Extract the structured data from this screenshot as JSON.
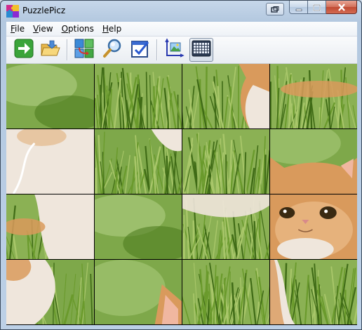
{
  "window": {
    "title": "PuzzlePicz"
  },
  "menu": [
    "File",
    "View",
    "Options",
    "Help"
  ],
  "toolbar": {
    "buttons": [
      {
        "name": "start-button",
        "icon": "green-arrow-icon"
      },
      {
        "name": "open-button",
        "icon": "open-folder-icon"
      },
      {
        "name": "shuffle-button",
        "icon": "swap-pieces-icon"
      },
      {
        "name": "preview-button",
        "icon": "magnifier-icon"
      },
      {
        "name": "check-button",
        "icon": "checkmark-icon"
      },
      {
        "name": "show-picture-button",
        "icon": "picture-axes-icon"
      },
      {
        "name": "grid-size-button",
        "icon": "grid-icon"
      }
    ]
  },
  "puzzle": {
    "rows": 4,
    "cols": 4,
    "tiles": [
      {
        "content": "grass-blur"
      },
      {
        "content": "grass"
      },
      {
        "content": "grass-cat-ear"
      },
      {
        "content": "grass-cat-paw"
      },
      {
        "content": "white-fur"
      },
      {
        "content": "grass-fur-corner"
      },
      {
        "content": "grass"
      },
      {
        "content": "kitten-head-top"
      },
      {
        "content": "fur-and-grass"
      },
      {
        "content": "grass-blur"
      },
      {
        "content": "grass-fur-top"
      },
      {
        "content": "kitten-face"
      },
      {
        "content": "fur-left"
      },
      {
        "content": "grass-cat-ear-bottom"
      },
      {
        "content": "grass"
      },
      {
        "content": "grass-fur-left"
      }
    ]
  },
  "colors": {
    "grass_dark": "#3f6b16",
    "grass_mid": "#6a9a2c",
    "grass_light": "#a9c76a",
    "fur_orange": "#d99a5c",
    "fur_white": "#efe6dc"
  }
}
